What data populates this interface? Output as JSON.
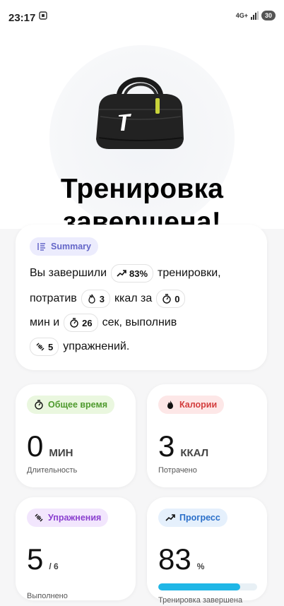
{
  "status_bar": {
    "time": "23:17",
    "network": "4G+",
    "battery": "30"
  },
  "hero": {
    "title_line1": "Тренировка",
    "title_line2": "завершена!"
  },
  "summary": {
    "label": "Summary",
    "line1_prefix": "Вы завершили",
    "completion_chip": "83%",
    "line1_suffix": "тренировки,",
    "line2_prefix": "потратив",
    "calories_chip": "3",
    "line2_mid": "ккал за",
    "minutes_chip": "0",
    "line3_prefix": "мин и",
    "seconds_chip": "26",
    "line3_suffix": "сек, выполнив",
    "exercises_chip": "5",
    "line4_suffix": "упражнений."
  },
  "stats": {
    "time": {
      "label": "Общее время",
      "value": "0",
      "unit": "МИН",
      "caption": "Длительность",
      "color": "#4e9a2d",
      "bg": "#eaf7df"
    },
    "calories": {
      "label": "Калории",
      "value": "3",
      "unit": "ККАЛ",
      "caption": "Потрачено",
      "color": "#d33d3d",
      "bg": "#fde7e7"
    },
    "exercises": {
      "label": "Упражнения",
      "value": "5",
      "unit": "/ 6",
      "caption": "Выполнено",
      "color": "#8a3fcf",
      "bg": "#f2e6fd"
    },
    "progress": {
      "label": "Прогресс",
      "value": "83",
      "unit": "%",
      "caption": "Тренировка завершена",
      "fraction": 0.83,
      "color": "#2a6fc9",
      "bg": "#e5f0fc"
    }
  }
}
